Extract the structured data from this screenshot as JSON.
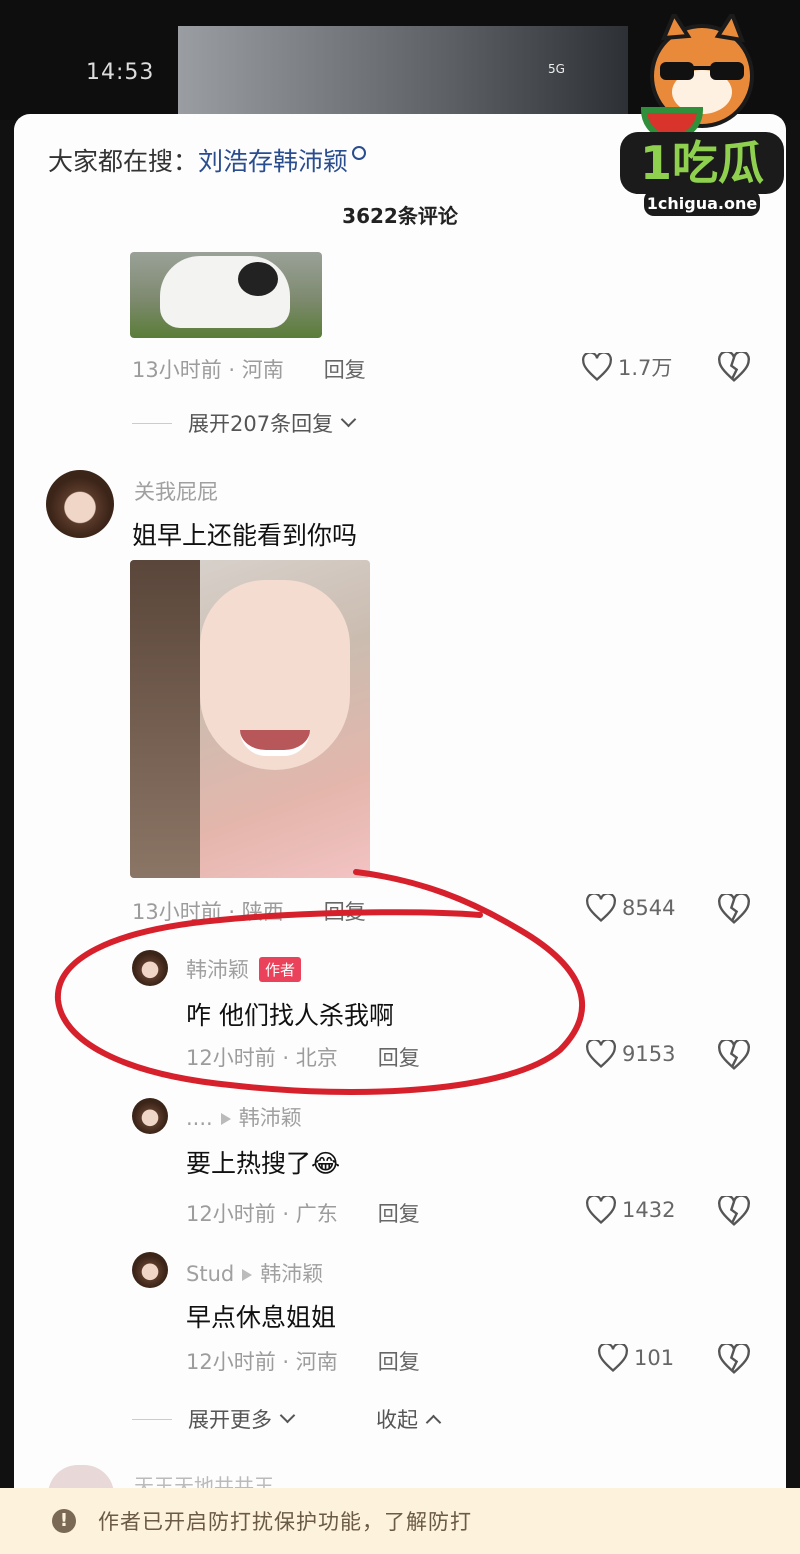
{
  "status_bar": {
    "time": "14:53",
    "network": "5G"
  },
  "search_hint": {
    "prefix": "大家都在搜：",
    "keyword": "刘浩存韩沛颖"
  },
  "comment_count": "3622条评论",
  "comments": [
    {
      "meta_time": "13小时前",
      "meta_region": "河南",
      "reply_label": "回复",
      "likes": "1.7万",
      "expand_label": "展开207条回复"
    },
    {
      "user": "关我屁屁",
      "text": "姐早上还能看到你吗",
      "meta_time": "13小时前",
      "meta_region": "陕西",
      "reply_label": "回复",
      "likes": "8544"
    }
  ],
  "replies": [
    {
      "user": "韩沛颖",
      "tag": "作者",
      "text": "咋 他们找人杀我啊",
      "meta_time": "12小时前",
      "meta_region": "北京",
      "reply_label": "回复",
      "likes": "9153"
    },
    {
      "user": "....",
      "reply_to": "韩沛颖",
      "text": "要上热搜了😂",
      "meta_time": "12小时前",
      "meta_region": "广东",
      "reply_label": "回复",
      "likes": "1432"
    },
    {
      "user": "Stud",
      "reply_to": "韩沛颖",
      "text": "早点休息姐姐",
      "meta_time": "12小时前",
      "meta_region": "河南",
      "reply_label": "回复",
      "likes": "101"
    }
  ],
  "thread_controls": {
    "expand_more": "展开更多",
    "collapse": "收起"
  },
  "next_comment_user": "天王天地共共王",
  "banner": {
    "text": "作者已开启防打扰保护功能，了解防打"
  },
  "watermark": {
    "brand": "1吃瓜",
    "url": "1chigua.one"
  },
  "colors": {
    "annotation": "#d6212c",
    "author_tag": "#e9425a",
    "keyword": "#2a4d8f",
    "banner_bg": "#fdf3dc"
  },
  "icons": [
    "heart-icon",
    "broken-heart-icon",
    "search-icon",
    "chevron-down-icon",
    "chevron-up-icon",
    "warning-icon"
  ]
}
